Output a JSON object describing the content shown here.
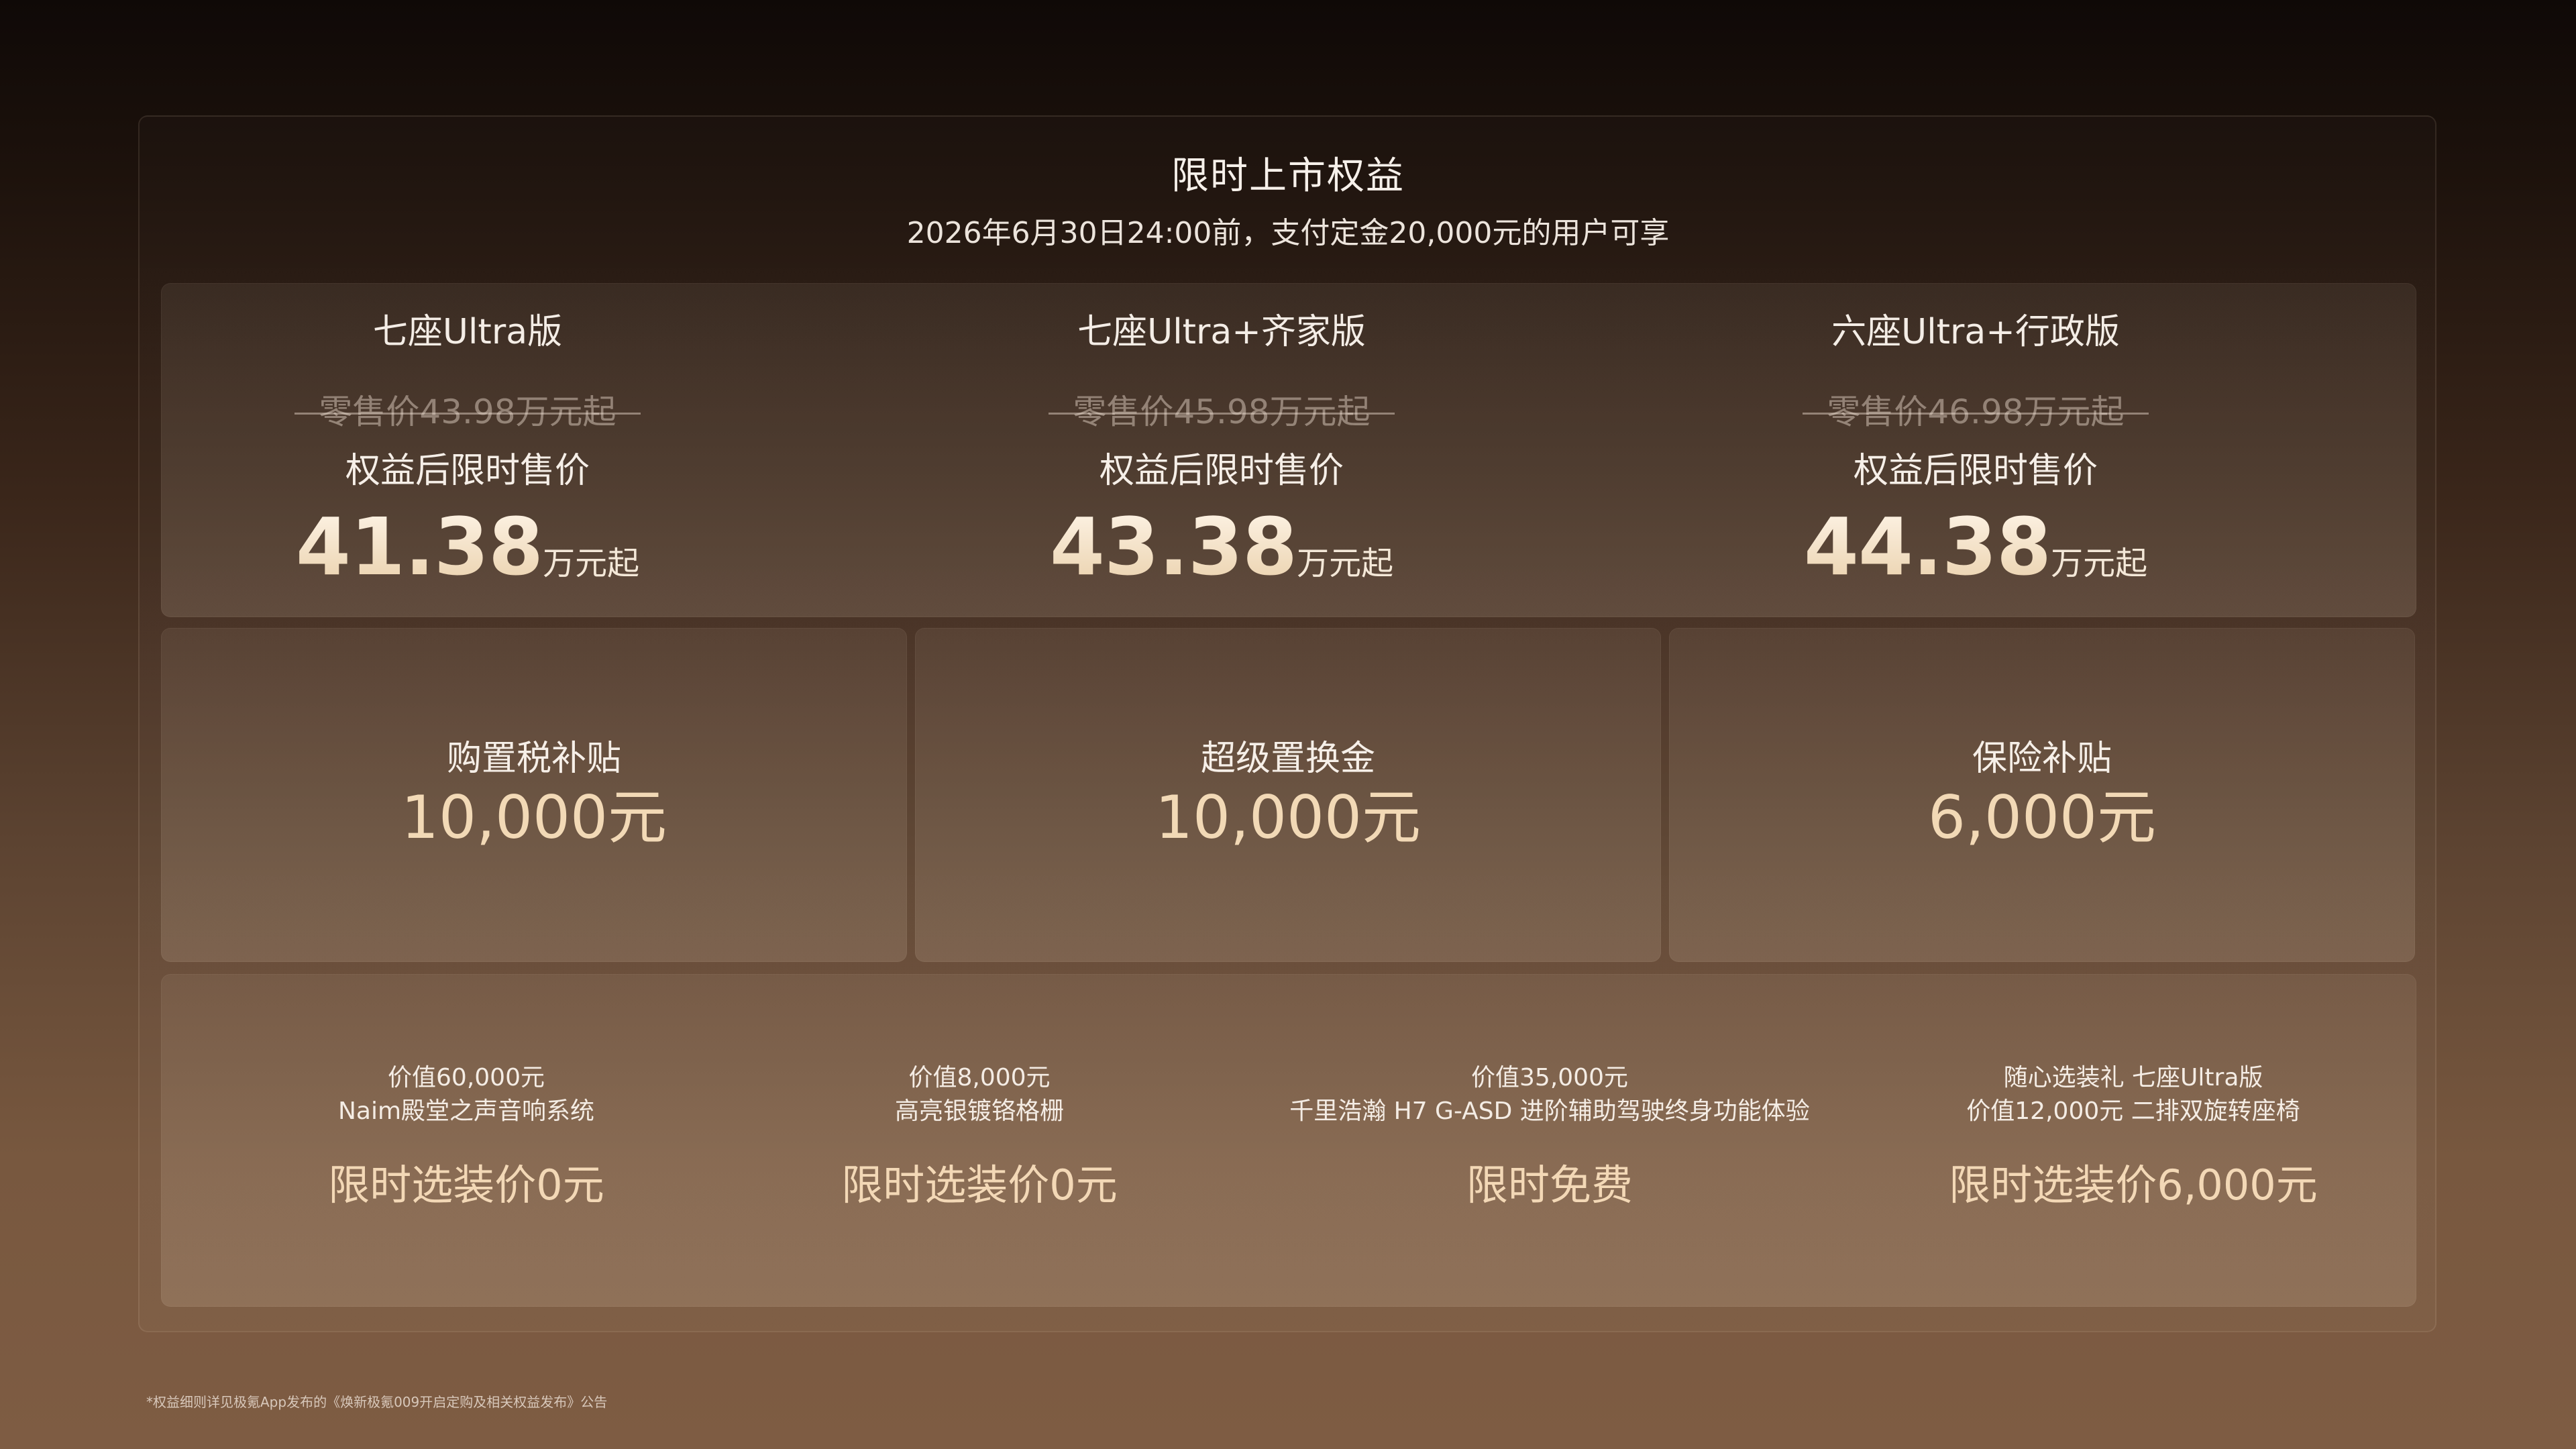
{
  "header": {
    "title": "限时上市权益",
    "subtitle": "2026年6月30日24:00前，支付定金20,000元的用户可享"
  },
  "models": [
    {
      "name": "七座Ultra版",
      "original_price": "零售价43.98万元起",
      "promo_label": "权益后限时售价",
      "promo_price": "41.38",
      "promo_unit": "万元起"
    },
    {
      "name": "七座Ultra+齐家版",
      "original_price": "零售价45.98万元起",
      "promo_label": "权益后限时售价",
      "promo_price": "43.38",
      "promo_unit": "万元起"
    },
    {
      "name": "六座Ultra+行政版",
      "original_price": "零售价46.98万元起",
      "promo_label": "权益后限时售价",
      "promo_price": "44.38",
      "promo_unit": "万元起"
    }
  ],
  "perks": [
    {
      "title": "购置税补贴",
      "value": "10,000元"
    },
    {
      "title": "超级置换金",
      "value": "10,000元"
    },
    {
      "title": "保险补贴",
      "value": "6,000元"
    }
  ],
  "gifts": [
    {
      "line1": "价值60,000元",
      "line2": "Naim殿堂之声音响系统",
      "offer": "限时选装价0元"
    },
    {
      "line1": "价值8,000元",
      "line2": "高亮银镀铬格栅",
      "offer": "限时选装价0元"
    },
    {
      "line1": "价值35,000元",
      "line2": "千里浩瀚 H7 G-ASD 进阶辅助驾驶终身功能体验",
      "offer": "限时免费"
    },
    {
      "line1": "随心选装礼 七座Ultra版",
      "line2": "价值12,000元 二排双旋转座椅",
      "offer": "限时选装价6,000元"
    }
  ],
  "footnote": "*权益细则详见极氪App发布的《焕新极氪009开启定购及相关权益发布》公告"
}
